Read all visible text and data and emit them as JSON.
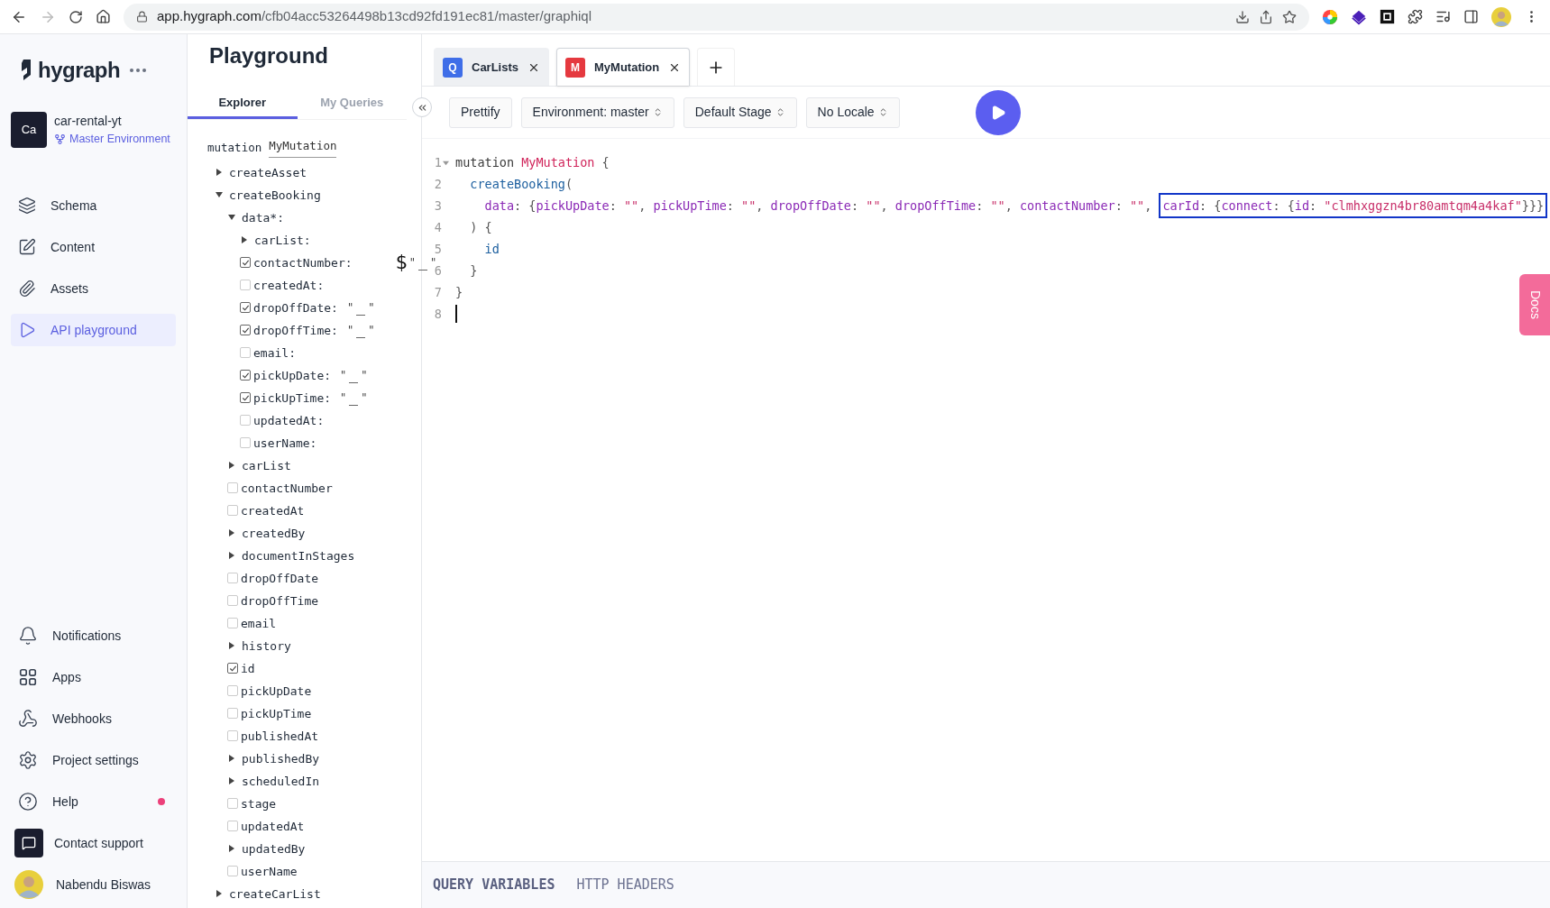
{
  "browser": {
    "url_host": "app.hygraph.com",
    "url_path": "/cfb04acc53264498b13cd92fd191ec81/master/graphiql",
    "forward_disabled": true
  },
  "sidebar": {
    "logo": "hygraph",
    "project": {
      "initials": "Ca",
      "name": "car-rental-yt",
      "environment": "Master Environment"
    },
    "nav": [
      {
        "label": "Schema",
        "selected": false
      },
      {
        "label": "Content",
        "selected": false
      },
      {
        "label": "Assets",
        "selected": false
      },
      {
        "label": "API playground",
        "selected": true
      }
    ],
    "bottom_nav": [
      {
        "label": "Notifications",
        "notification_dot": false
      },
      {
        "label": "Apps",
        "notification_dot": false
      },
      {
        "label": "Webhooks",
        "notification_dot": false
      },
      {
        "label": "Project settings",
        "notification_dot": false
      },
      {
        "label": "Help",
        "notification_dot": true
      },
      {
        "label": "Contact support",
        "notification_dot": false
      }
    ],
    "user": {
      "name": "Nabendu Biswas"
    }
  },
  "explorer": {
    "title": "Playground",
    "tabs": [
      {
        "label": "Explorer",
        "selected": true
      },
      {
        "label": "My Queries",
        "selected": false
      }
    ],
    "operation": {
      "keyword": "mutation",
      "name": "MyMutation"
    },
    "tree": [
      {
        "label": "createAsset",
        "kind": "arrow",
        "expanded": false
      },
      {
        "label": "createBooking",
        "kind": "arrow",
        "expanded": true,
        "children": [
          {
            "label": "data*:",
            "kind": "arrow",
            "expanded": true,
            "children": [
              {
                "label": "carList:",
                "kind": "arrow",
                "expanded": false
              },
              {
                "label": "contactNumber:",
                "kind": "checkbox",
                "checked": true,
                "variable": "$",
                "value": {
                  "open": "\"",
                  "close": "\""
                }
              },
              {
                "label": "createdAt:",
                "kind": "checkbox",
                "checked": false
              },
              {
                "label": "dropOffDate:",
                "kind": "checkbox",
                "checked": true,
                "value": {
                  "open": "\"",
                  "close": "\""
                }
              },
              {
                "label": "dropOffTime:",
                "kind": "checkbox",
                "checked": true,
                "value": {
                  "open": "\"",
                  "close": "\""
                }
              },
              {
                "label": "email:",
                "kind": "checkbox",
                "checked": false
              },
              {
                "label": "pickUpDate:",
                "kind": "checkbox",
                "checked": true,
                "value": {
                  "open": "\"",
                  "close": "\""
                }
              },
              {
                "label": "pickUpTime:",
                "kind": "checkbox",
                "checked": true,
                "value": {
                  "open": "\"",
                  "close": "\""
                }
              },
              {
                "label": "updatedAt:",
                "kind": "checkbox",
                "checked": false
              },
              {
                "label": "userName:",
                "kind": "checkbox",
                "checked": false
              }
            ]
          },
          {
            "label": "carList",
            "kind": "arrow",
            "expanded": false
          },
          {
            "label": "contactNumber",
            "kind": "checkbox",
            "checked": false
          },
          {
            "label": "createdAt",
            "kind": "checkbox",
            "checked": false
          },
          {
            "label": "createdBy",
            "kind": "arrow",
            "expanded": false
          },
          {
            "label": "documentInStages",
            "kind": "arrow",
            "expanded": false
          },
          {
            "label": "dropOffDate",
            "kind": "checkbox",
            "checked": false
          },
          {
            "label": "dropOffTime",
            "kind": "checkbox",
            "checked": false
          },
          {
            "label": "email",
            "kind": "checkbox",
            "checked": false
          },
          {
            "label": "history",
            "kind": "arrow",
            "expanded": false
          },
          {
            "label": "id",
            "kind": "checkbox",
            "checked": true
          },
          {
            "label": "pickUpDate",
            "kind": "checkbox",
            "checked": false
          },
          {
            "label": "pickUpTime",
            "kind": "checkbox",
            "checked": false
          },
          {
            "label": "publishedAt",
            "kind": "checkbox",
            "checked": false
          },
          {
            "label": "publishedBy",
            "kind": "arrow",
            "expanded": false
          },
          {
            "label": "scheduledIn",
            "kind": "arrow",
            "expanded": false
          },
          {
            "label": "stage",
            "kind": "checkbox",
            "checked": false
          },
          {
            "label": "updatedAt",
            "kind": "checkbox",
            "checked": false
          },
          {
            "label": "updatedBy",
            "kind": "arrow",
            "expanded": false
          },
          {
            "label": "userName",
            "kind": "checkbox",
            "checked": false
          }
        ]
      },
      {
        "label": "createCarList",
        "kind": "arrow",
        "expanded": false
      }
    ]
  },
  "editor": {
    "tabs": [
      {
        "label": "CarLists",
        "badge": "Q",
        "color": "#3f6ee8",
        "selected": false
      },
      {
        "label": "MyMutation",
        "badge": "M",
        "color": "#e5393f",
        "selected": true
      }
    ],
    "toolbar": [
      {
        "label": "Prettify",
        "kind": "button"
      },
      {
        "label": "Environment: master",
        "kind": "select"
      },
      {
        "label": "Default Stage",
        "kind": "select"
      },
      {
        "label": "No Locale",
        "kind": "select"
      }
    ],
    "lines": [
      {
        "number": "1",
        "foldable": true,
        "cursor": false,
        "segments": [
          {
            "boxed": false,
            "tokens": [
              {
                "kind": "keyword",
                "text": "mutation "
              },
              {
                "kind": "def",
                "text": "MyMutation"
              },
              {
                "kind": "punct",
                "text": " {"
              }
            ]
          }
        ]
      },
      {
        "number": "2",
        "foldable": false,
        "cursor": false,
        "segments": [
          {
            "boxed": false,
            "tokens": [
              {
                "kind": "field",
                "text": "  createBooking"
              },
              {
                "kind": "punct",
                "text": "("
              }
            ]
          }
        ]
      },
      {
        "number": "3",
        "foldable": false,
        "cursor": false,
        "segments": [
          {
            "boxed": false,
            "tokens": [
              {
                "kind": "attribute",
                "text": "    data"
              },
              {
                "kind": "punct",
                "text": ": {"
              },
              {
                "kind": "attribute",
                "text": "pickUpDate"
              },
              {
                "kind": "punct",
                "text": ": "
              },
              {
                "kind": "string",
                "text": "\"\""
              },
              {
                "kind": "punct",
                "text": ", "
              },
              {
                "kind": "attribute",
                "text": "pickUpTime"
              },
              {
                "kind": "punct",
                "text": ": "
              },
              {
                "kind": "string",
                "text": "\"\""
              },
              {
                "kind": "punct",
                "text": ", "
              },
              {
                "kind": "attribute",
                "text": "dropOffDate"
              },
              {
                "kind": "punct",
                "text": ": "
              },
              {
                "kind": "string",
                "text": "\"\""
              },
              {
                "kind": "punct",
                "text": ", "
              },
              {
                "kind": "attribute",
                "text": "dropOffTime"
              },
              {
                "kind": "punct",
                "text": ": "
              },
              {
                "kind": "string",
                "text": "\"\""
              },
              {
                "kind": "punct",
                "text": ", "
              },
              {
                "kind": "attribute",
                "text": "contactNumber"
              },
              {
                "kind": "punct",
                "text": ": "
              },
              {
                "kind": "string",
                "text": "\"\""
              },
              {
                "kind": "punct",
                "text": ", "
              }
            ]
          },
          {
            "boxed": true,
            "tokens": [
              {
                "kind": "attribute",
                "text": "carId"
              },
              {
                "kind": "punct",
                "text": ": {"
              },
              {
                "kind": "attribute",
                "text": "connect"
              },
              {
                "kind": "punct",
                "text": ": {"
              },
              {
                "kind": "attribute",
                "text": "id"
              },
              {
                "kind": "punct",
                "text": ": "
              },
              {
                "kind": "string",
                "text": "\"clmhxggzn4br80amtqm4a4kaf\""
              },
              {
                "kind": "punct",
                "text": "}}}"
              }
            ]
          }
        ]
      },
      {
        "number": "4",
        "foldable": false,
        "cursor": false,
        "segments": [
          {
            "boxed": false,
            "tokens": [
              {
                "kind": "punct",
                "text": "  ) {"
              }
            ]
          }
        ]
      },
      {
        "number": "5",
        "foldable": false,
        "cursor": false,
        "segments": [
          {
            "boxed": false,
            "tokens": [
              {
                "kind": "field",
                "text": "    id"
              }
            ]
          }
        ]
      },
      {
        "number": "6",
        "foldable": false,
        "cursor": false,
        "segments": [
          {
            "boxed": false,
            "tokens": [
              {
                "kind": "punct",
                "text": "  }"
              }
            ]
          }
        ]
      },
      {
        "number": "7",
        "foldable": false,
        "cursor": false,
        "segments": [
          {
            "boxed": false,
            "tokens": [
              {
                "kind": "punct",
                "text": "}"
              }
            ]
          }
        ]
      },
      {
        "number": "8",
        "foldable": false,
        "cursor": true
      }
    ],
    "docs_tab": "Docs",
    "bottom_tabs": [
      {
        "label": "QUERY VARIABLES",
        "selected": true
      },
      {
        "label": "HTTP HEADERS",
        "selected": false
      }
    ]
  }
}
